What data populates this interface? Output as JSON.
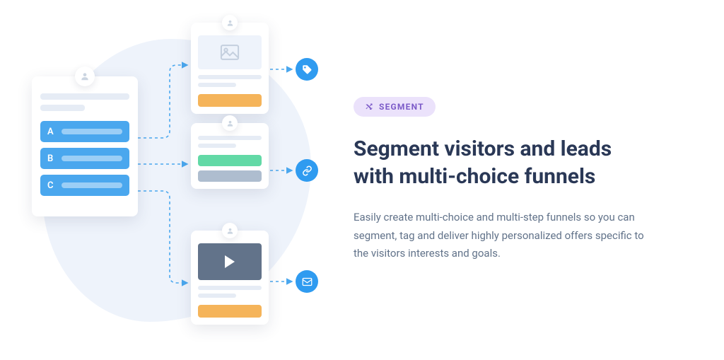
{
  "pill": {
    "label": "SEGMENT"
  },
  "heading": "Segment visitors and leads with multi-choice funnels",
  "description": "Easily create multi-choice and multi-step funnels so you can segment, tag and deliver highly personalized offers specific to the visitors interests and goals.",
  "diagram": {
    "options": [
      "A",
      "B",
      "C"
    ],
    "branches": [
      {
        "thumb": "image",
        "cta_color": "#f5b45a",
        "badge": "tag"
      },
      {
        "buttons": [
          "green",
          "gray"
        ],
        "badge": "link"
      },
      {
        "thumb": "video",
        "cta_color": "#f5b45a",
        "badge": "mail"
      }
    ]
  },
  "colors": {
    "accent_blue": "#4aa7ee",
    "badge_blue": "#2f9bf0",
    "cta_orange": "#f5b45a",
    "green": "#62d9a6",
    "heading": "#2a3856",
    "body": "#62738a",
    "pill_bg": "#ebe2fb",
    "pill_fg": "#7b5ac8"
  }
}
